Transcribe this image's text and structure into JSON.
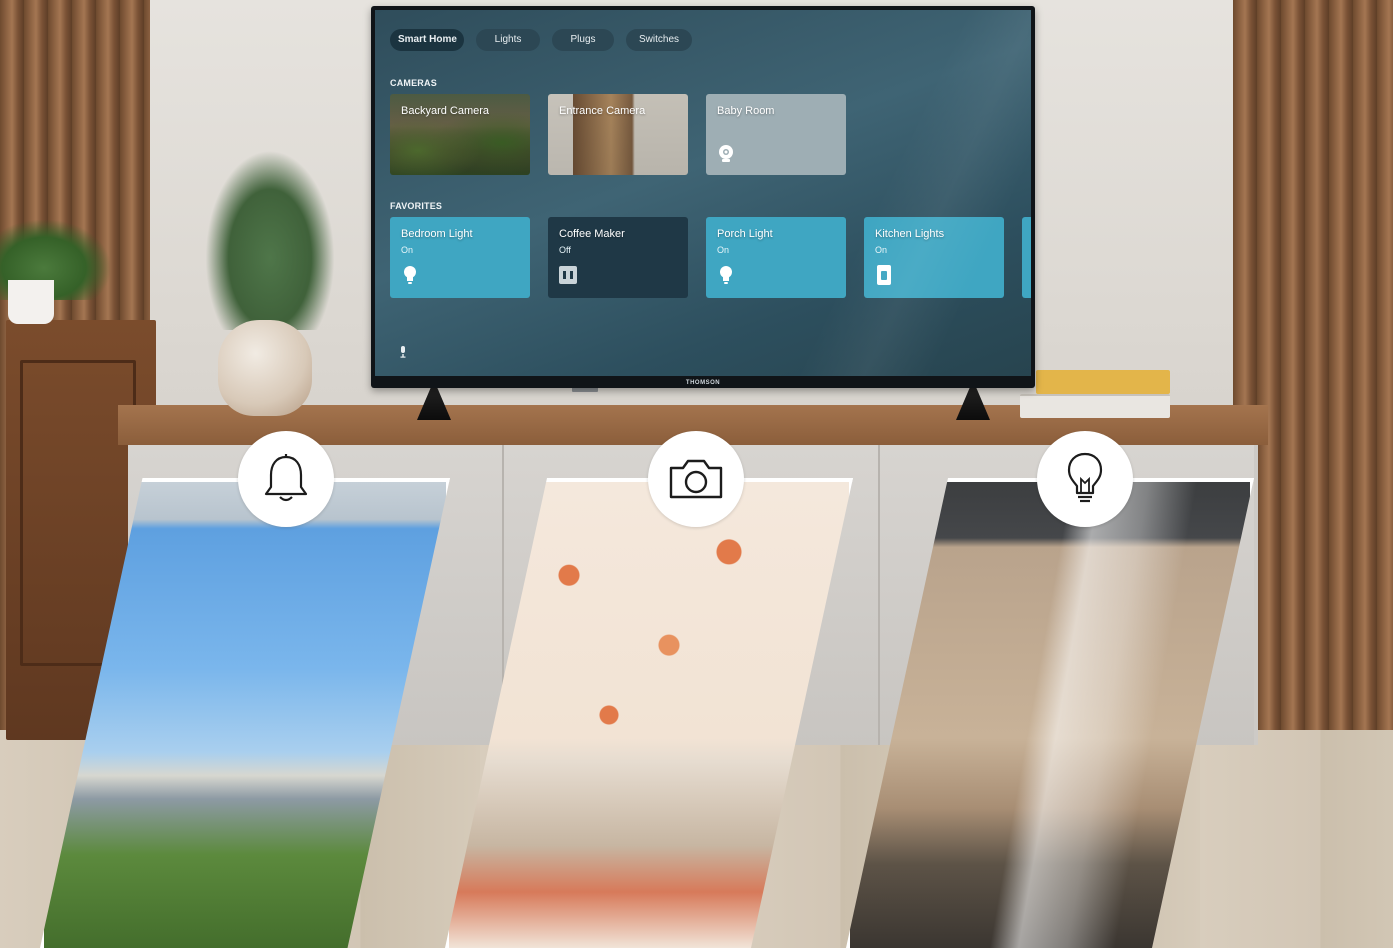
{
  "tv": {
    "brand": "THOMSON",
    "tabs": [
      {
        "label": "Smart Home",
        "active": true
      },
      {
        "label": "Lights",
        "active": false
      },
      {
        "label": "Plugs",
        "active": false
      },
      {
        "label": "Switches",
        "active": false
      }
    ],
    "sections": {
      "cameras": "CAMERAS",
      "favorites": "FAVORITES"
    },
    "cameras": [
      {
        "label": "Backyard Camera"
      },
      {
        "label": "Entrance Camera"
      },
      {
        "label": "Baby Room",
        "icon": "camera-device-icon"
      }
    ],
    "favorites": [
      {
        "label": "Bedroom Light",
        "status": "On",
        "icon": "lightbulb-icon"
      },
      {
        "label": "Coffee Maker",
        "status": "Off",
        "icon": "plug-icon"
      },
      {
        "label": "Porch Light",
        "status": "On",
        "icon": "lightbulb-icon"
      },
      {
        "label": "Kitchen Lights",
        "status": "On",
        "icon": "light-switch-icon"
      }
    ],
    "colors": {
      "active_tile": "#3fa6c2",
      "inactive_tile": "#1f3846",
      "screen_bg": "#34586a"
    }
  },
  "features": [
    {
      "icon": "bell-icon"
    },
    {
      "icon": "camera-icon"
    },
    {
      "icon": "lightbulb-icon"
    }
  ]
}
